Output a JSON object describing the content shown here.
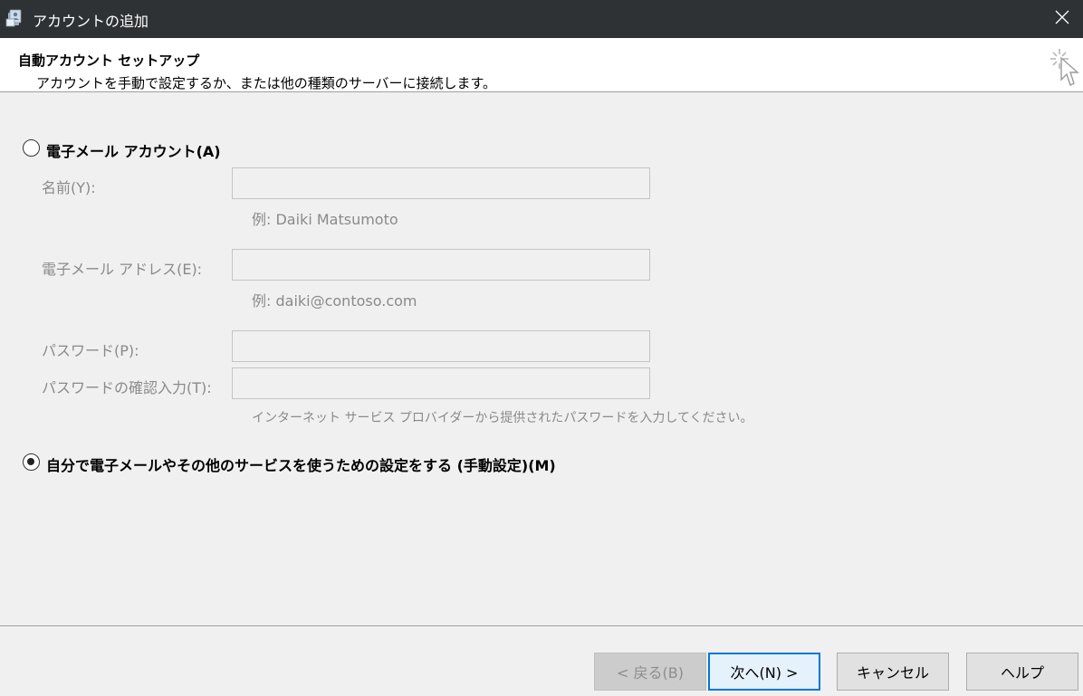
{
  "window": {
    "title": "アカウントの追加",
    "close_glyph": "✕"
  },
  "header": {
    "title": "自動アカウント セットアップ",
    "subtitle": "アカウントを手動で設定するか、または他の種類のサーバーに接続します。"
  },
  "options": {
    "email_account": {
      "label": "電子メール アカウント(A)",
      "selected": false
    },
    "manual_setup": {
      "label": "自分で電子メールやその他のサービスを使うための設定をする (手動設定)(M)",
      "selected": true
    }
  },
  "fields": {
    "name": {
      "label": "名前(Y):",
      "value": "",
      "example": "例: Daiki Matsumoto"
    },
    "email": {
      "label": "電子メール アドレス(E):",
      "value": "",
      "example": "例: daiki@contoso.com"
    },
    "password": {
      "label": "パスワード(P):",
      "value": ""
    },
    "password_confirm": {
      "label": "パスワードの確認入力(T):",
      "value": ""
    },
    "password_note": "インターネット サービス プロバイダーから提供されたパスワードを入力してください。"
  },
  "buttons": {
    "back": "< 戻る(B)",
    "next": "次へ(N) >",
    "cancel": "キャンセル",
    "help": "ヘルプ"
  },
  "icons": {
    "app": "outlook-account-icon",
    "close": "close-icon",
    "wizard": "sparkle-cursor-icon"
  },
  "colors": {
    "titlebar": "#2f3235",
    "accent": "#0078d7",
    "disabled_text": "#8a8a8a"
  }
}
